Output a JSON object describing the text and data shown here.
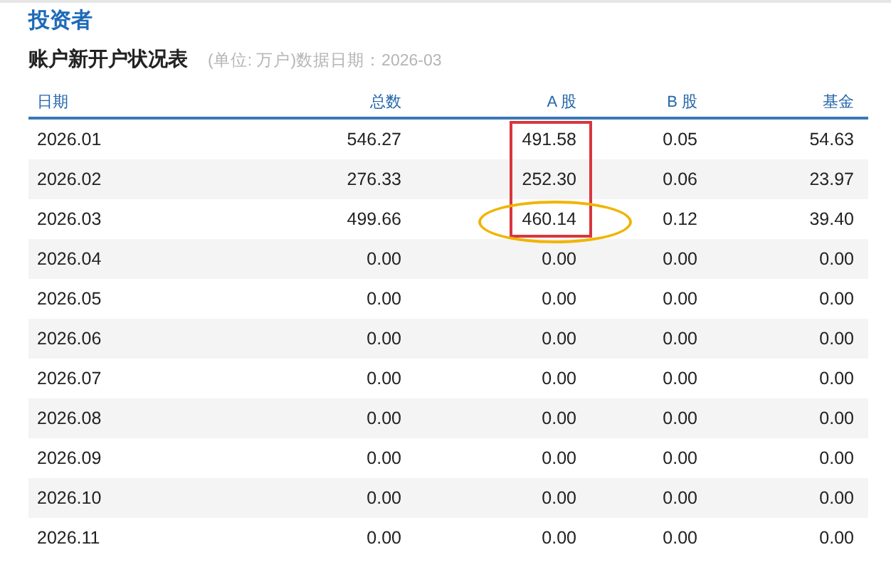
{
  "section_title": "投资者",
  "table_title": "账户新开户状况表",
  "table_note": "(单位: 万户)数据日期：2026-03",
  "columns": [
    "日期",
    "总数",
    "A 股",
    "B 股",
    "基金"
  ],
  "rows": [
    [
      "2026.01",
      "546.27",
      "491.58",
      "0.05",
      "54.63"
    ],
    [
      "2026.02",
      "276.33",
      "252.30",
      "0.06",
      "23.97"
    ],
    [
      "2026.03",
      "499.66",
      "460.14",
      "0.12",
      "39.40"
    ],
    [
      "2026.04",
      "0.00",
      "0.00",
      "0.00",
      "0.00"
    ],
    [
      "2026.05",
      "0.00",
      "0.00",
      "0.00",
      "0.00"
    ],
    [
      "2026.06",
      "0.00",
      "0.00",
      "0.00",
      "0.00"
    ],
    [
      "2026.07",
      "0.00",
      "0.00",
      "0.00",
      "0.00"
    ],
    [
      "2026.08",
      "0.00",
      "0.00",
      "0.00",
      "0.00"
    ],
    [
      "2026.09",
      "0.00",
      "0.00",
      "0.00",
      "0.00"
    ],
    [
      "2026.10",
      "0.00",
      "0.00",
      "0.00",
      "0.00"
    ],
    [
      "2026.11",
      "0.00",
      "0.00",
      "0.00",
      "0.00"
    ]
  ],
  "annotations": [
    {
      "kind": "box",
      "color": "#d9363e"
    },
    {
      "kind": "ellipse",
      "color": "#f0b400"
    }
  ]
}
